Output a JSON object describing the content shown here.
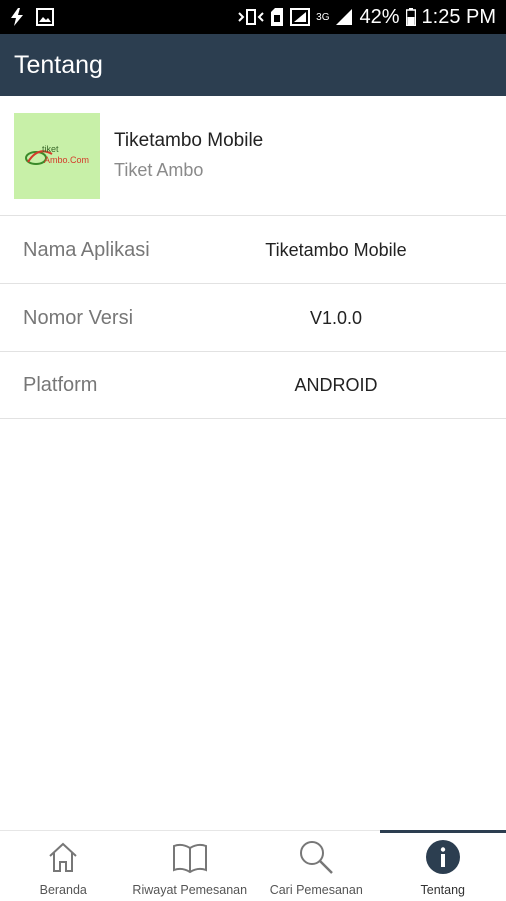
{
  "status_bar": {
    "battery_percent": "42%",
    "time": "1:25 PM",
    "network": "3G",
    "icons": [
      "flash-icon",
      "image-icon",
      "vibrate-icon",
      "sim-icon",
      "signal-icon",
      "battery-icon"
    ]
  },
  "app_bar": {
    "title": "Tentang"
  },
  "app_header": {
    "name": "Tiketambo Mobile",
    "subtitle": "Tiket Ambo",
    "logo_line1": "tiket",
    "logo_line2": "Ambo.Com"
  },
  "info_rows": [
    {
      "label": "Nama Aplikasi",
      "value": "Tiketambo Mobile"
    },
    {
      "label": "Nomor Versi",
      "value": "V1.0.0"
    },
    {
      "label": "Platform",
      "value": "ANDROID"
    }
  ],
  "bottom_nav": {
    "items": [
      {
        "label": "Beranda",
        "icon": "home-icon"
      },
      {
        "label": "Riwayat Pemesanan",
        "icon": "book-icon"
      },
      {
        "label": "Cari Pemesanan",
        "icon": "search-icon"
      },
      {
        "label": "Tentang",
        "icon": "info-icon",
        "active": true
      }
    ]
  },
  "colors": {
    "primary": "#2c3e50",
    "logo_bg": "#c8f0a8"
  }
}
